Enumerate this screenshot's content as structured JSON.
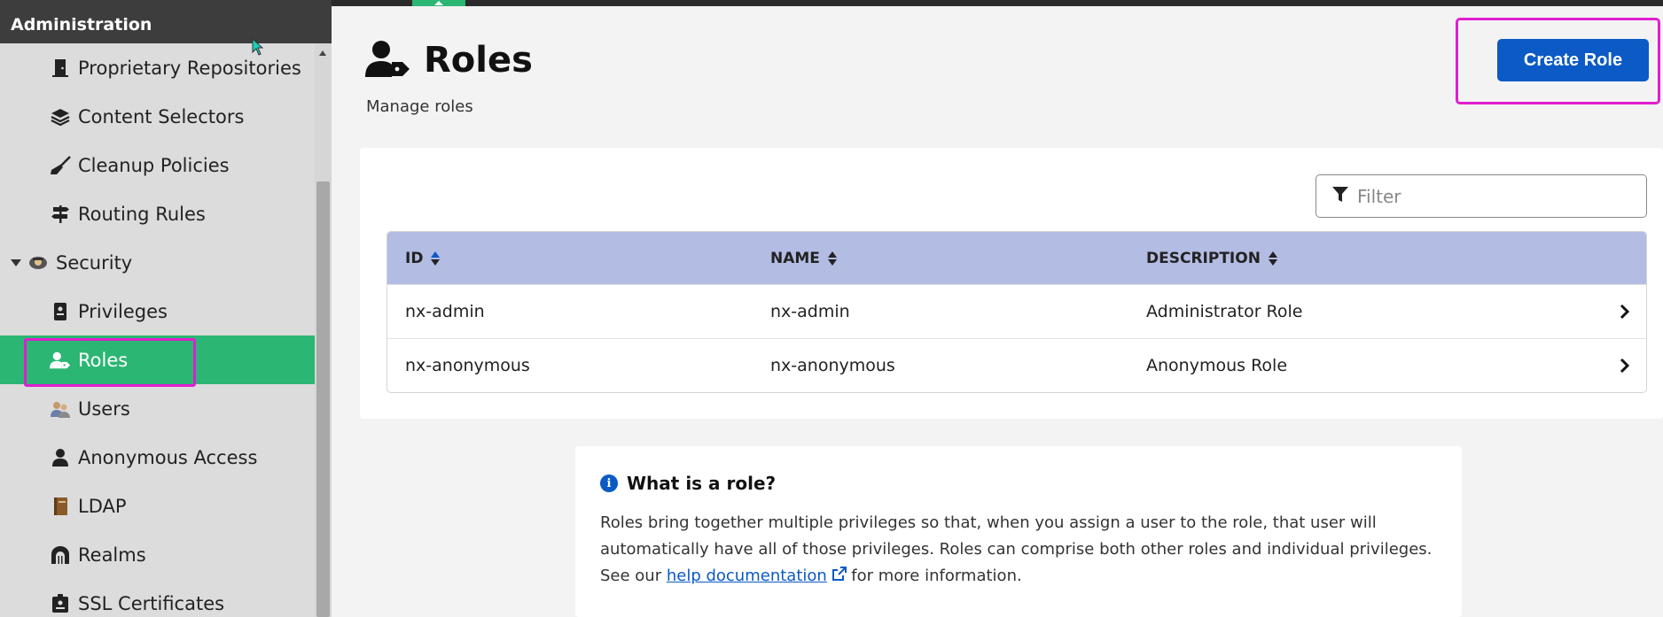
{
  "sidebar": {
    "title": "Administration",
    "items": [
      {
        "label": "Proprietary Repositories",
        "icon": "door-icon"
      },
      {
        "label": "Content Selectors",
        "icon": "layers-icon"
      },
      {
        "label": "Cleanup Policies",
        "icon": "broom-icon"
      },
      {
        "label": "Routing Rules",
        "icon": "signpost-icon"
      }
    ],
    "group": {
      "label": "Security",
      "icon": "security-guard-icon"
    },
    "security_items": [
      {
        "label": "Privileges",
        "icon": "badge-icon"
      },
      {
        "label": "Roles",
        "icon": "user-tag-icon",
        "active": true
      },
      {
        "label": "Users",
        "icon": "users-icon"
      },
      {
        "label": "Anonymous Access",
        "icon": "user-icon"
      },
      {
        "label": "LDAP",
        "icon": "book-icon"
      },
      {
        "label": "Realms",
        "icon": "dungeon-icon"
      },
      {
        "label": "SSL Certificates",
        "icon": "id-card-icon"
      }
    ]
  },
  "header": {
    "title": "Roles",
    "subtitle": "Manage roles",
    "create_label": "Create Role"
  },
  "filter": {
    "placeholder": "Filter"
  },
  "table": {
    "headers": [
      "ID",
      "NAME",
      "DESCRIPTION"
    ],
    "rows": [
      {
        "id": "nx-admin",
        "name": "nx-admin",
        "description": "Administrator Role"
      },
      {
        "id": "nx-anonymous",
        "name": "nx-anonymous",
        "description": "Anonymous Role"
      }
    ]
  },
  "info": {
    "title": "What is a role?",
    "text_before": "Roles bring together multiple privileges so that, when you assign a user to the role, that user will automatically have all of those privileges. Roles can comprise both other roles and individual privileges. See our ",
    "link": "help documentation",
    "text_after": " for more information."
  },
  "colors": {
    "accent": "#2bb673",
    "primary": "#0b5ac5",
    "highlight": "#e01ecf",
    "table_header": "#b3bce3"
  }
}
